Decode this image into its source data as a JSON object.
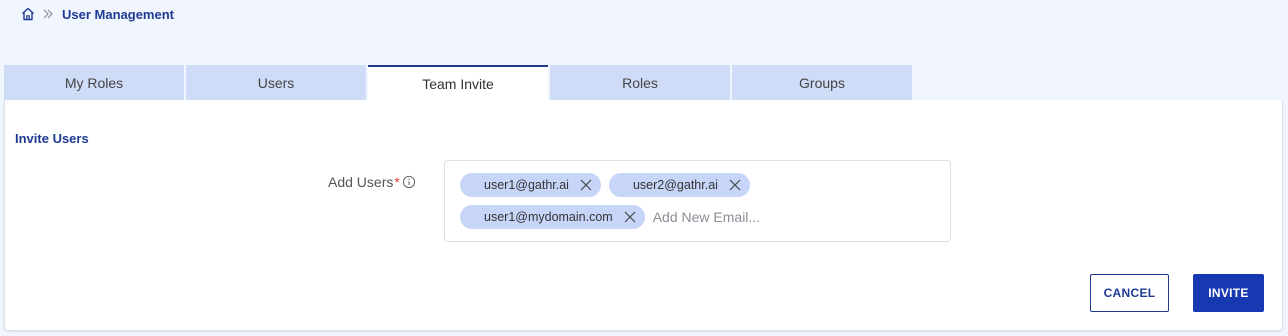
{
  "breadcrumb": {
    "home_icon": "home-icon",
    "separator_icon": "double-chevron-right-icon",
    "current": "User Management"
  },
  "tabs": [
    {
      "label": "My Roles",
      "active": false
    },
    {
      "label": "Users",
      "active": false
    },
    {
      "label": "Team Invite",
      "active": true
    },
    {
      "label": "Roles",
      "active": false
    },
    {
      "label": "Groups",
      "active": false
    }
  ],
  "invite": {
    "section_title": "Invite Users",
    "field_label": "Add Users",
    "required_mark": "*",
    "info_icon": "info-icon",
    "chips": [
      "user1@gathr.ai",
      "user2@gathr.ai",
      "user1@mydomain.com"
    ],
    "input_placeholder": "Add New Email...",
    "input_value": ""
  },
  "actions": {
    "cancel_label": "CANCEL",
    "invite_label": "INVITE"
  },
  "colors": {
    "brand": "#1f3a93",
    "primary_button": "#1638b0",
    "tab_inactive": "#cfdcf8",
    "chip": "#c7d6f8",
    "required": "#e53935",
    "background": "#f1f5fd"
  }
}
